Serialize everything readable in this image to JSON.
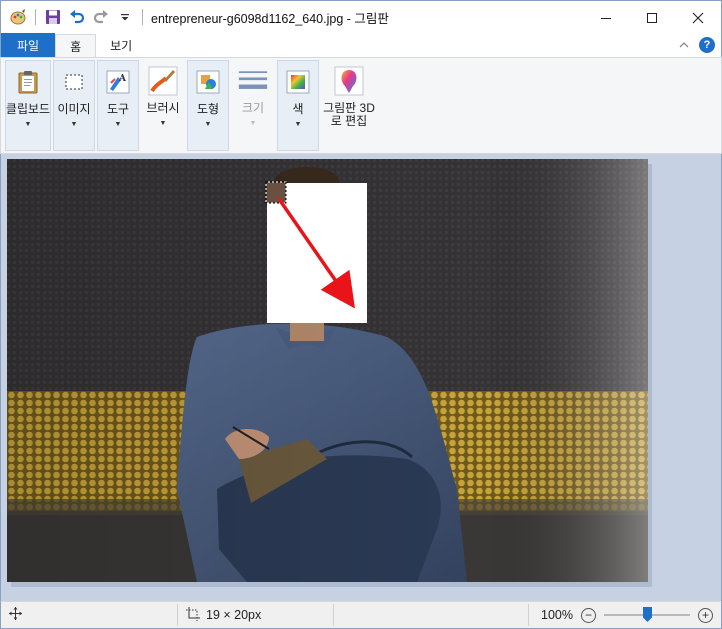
{
  "window": {
    "title": "entrepreneur-g6098d1162_640.jpg - 그림판",
    "minimize_icon": "minimize-icon",
    "maximize_icon": "maximize-icon",
    "close_icon": "close-icon"
  },
  "quick_access": {
    "icons": [
      "paint-app-icon",
      "save-icon",
      "undo-icon",
      "redo-icon",
      "customize-dropdown-icon"
    ]
  },
  "tabs": {
    "file": "파일",
    "home": "홈",
    "view": "보기",
    "collapse_icon": "chevron-up-icon",
    "help": "?"
  },
  "ribbon": {
    "clipboard": "클립보드",
    "image": "이미지",
    "tools": "도구",
    "brushes": "브러시",
    "shapes": "도형",
    "size": "크기",
    "colors": "색",
    "paint3d": "그림판 3D로 편집"
  },
  "status": {
    "selection_size": "19 × 20px",
    "zoom": "100%",
    "zoom_fraction": 0.5
  },
  "colors": {
    "accent": "#1f6fc8",
    "canvas_bg": "#c6d2e3",
    "arrow": "#e8141a"
  }
}
